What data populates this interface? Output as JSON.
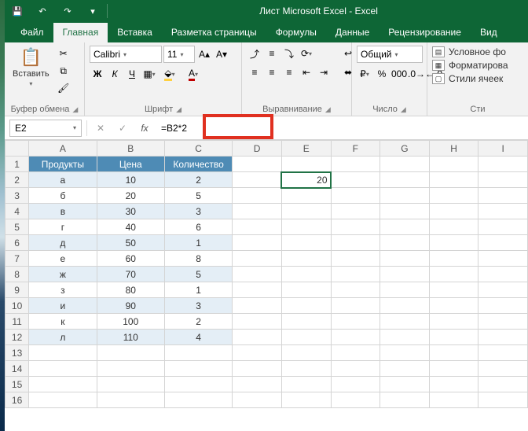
{
  "title": "Лист Microsoft Excel  -  Excel",
  "qat": {
    "save": "💾",
    "undo": "↶",
    "redo": "↷",
    "custom": "▾"
  },
  "tabs": [
    "Файл",
    "Главная",
    "Вставка",
    "Разметка страницы",
    "Формулы",
    "Данные",
    "Рецензирование",
    "Вид"
  ],
  "active_tab": 1,
  "ribbon": {
    "clipboard": {
      "paste": "Вставить",
      "label": "Буфер обмена"
    },
    "font": {
      "name": "Calibri",
      "size": "11",
      "bold": "Ж",
      "italic": "К",
      "underline": "Ч",
      "label": "Шрифт"
    },
    "align": {
      "label": "Выравнивание",
      "wrap": "↩",
      "merge": "⬌"
    },
    "number": {
      "format": "Общий",
      "label": "Число"
    },
    "styles": {
      "cond": "Условное фо",
      "format": "Форматирова",
      "cell": "Стили ячеек",
      "label": "Сти"
    }
  },
  "formula_bar": {
    "cell": "E2",
    "formula": "=B2*2"
  },
  "columns": [
    "A",
    "B",
    "C",
    "D",
    "E",
    "F",
    "G",
    "H",
    "I"
  ],
  "headers": {
    "A": "Продукты",
    "B": "Цена",
    "C": "Количество"
  },
  "rows": [
    {
      "n": 1
    },
    {
      "n": 2,
      "A": "а",
      "B": "10",
      "C": "2",
      "E": "20"
    },
    {
      "n": 3,
      "A": "б",
      "B": "20",
      "C": "5"
    },
    {
      "n": 4,
      "A": "в",
      "B": "30",
      "C": "3"
    },
    {
      "n": 5,
      "A": "г",
      "B": "40",
      "C": "6"
    },
    {
      "n": 6,
      "A": "д",
      "B": "50",
      "C": "1"
    },
    {
      "n": 7,
      "A": "е",
      "B": "60",
      "C": "8"
    },
    {
      "n": 8,
      "A": "ж",
      "B": "70",
      "C": "5"
    },
    {
      "n": 9,
      "A": "з",
      "B": "80",
      "C": "1"
    },
    {
      "n": 10,
      "A": "и",
      "B": "90",
      "C": "3"
    },
    {
      "n": 11,
      "A": "к",
      "B": "100",
      "C": "2"
    },
    {
      "n": 12,
      "A": "л",
      "B": "110",
      "C": "4"
    },
    {
      "n": 13
    },
    {
      "n": 14
    },
    {
      "n": 15
    },
    {
      "n": 16
    }
  ],
  "selected": {
    "row": 2,
    "col": "E"
  }
}
